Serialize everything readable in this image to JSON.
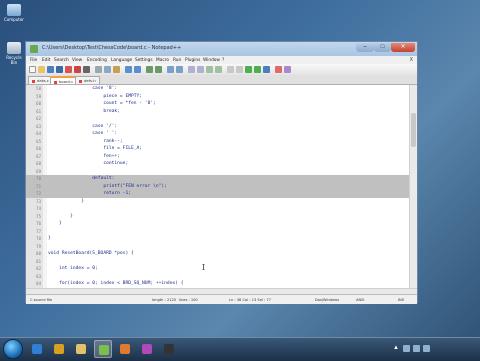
{
  "window": {
    "title": "C:\\Users\\Desktop\\Test\\ChessCode\\board.c - Notepad++",
    "min_glyph": "–",
    "max_glyph": "□",
    "close_glyph": "✕"
  },
  "desktop": {
    "icons": [
      {
        "label": "Computer",
        "icon": "computer-icon"
      },
      {
        "label": "Recycle Bin",
        "icon": "recycle-bin-icon"
      }
    ]
  },
  "menu": {
    "items": [
      "File",
      "Edit",
      "Search",
      "View",
      "Encoding",
      "Language",
      "Settings",
      "Macro",
      "Run",
      "Plugins",
      "Window",
      "?"
    ],
    "close_glyph": "X"
  },
  "tabs": [
    {
      "label": "data.c",
      "active": false
    },
    {
      "label": "board.c",
      "active": true
    },
    {
      "label": "defs.h",
      "active": false
    }
  ],
  "editor": {
    "selection_color": "#c0c0c0",
    "lines": [
      {
        "num": "58",
        "text": "                case '8':",
        "selected": false
      },
      {
        "num": "59",
        "text": "                    piece = EMPTY;",
        "selected": false
      },
      {
        "num": "60",
        "text": "                    count = *fen - '0';",
        "selected": false
      },
      {
        "num": "61",
        "text": "                    break;",
        "selected": false
      },
      {
        "num": "62",
        "text": "",
        "selected": false
      },
      {
        "num": "63",
        "text": "                case '/':",
        "selected": false
      },
      {
        "num": "64",
        "text": "                case ' ':",
        "selected": false
      },
      {
        "num": "65",
        "text": "                    rank--;",
        "selected": false
      },
      {
        "num": "66",
        "text": "                    file = FILE_A;",
        "selected": false
      },
      {
        "num": "67",
        "text": "                    fen++;",
        "selected": false
      },
      {
        "num": "68",
        "text": "                    continue;",
        "selected": false
      },
      {
        "num": "69",
        "text": "",
        "selected": false
      },
      {
        "num": "70",
        "text": "                default:",
        "selected": true
      },
      {
        "num": "71",
        "text": "                    printf(\"FEN error \\n\");",
        "selected": true
      },
      {
        "num": "72",
        "text": "                    return -1;",
        "selected": true
      },
      {
        "num": "73",
        "text": "            }",
        "selected": false
      },
      {
        "num": "74",
        "text": "",
        "selected": false
      },
      {
        "num": "75",
        "text": "        }",
        "selected": false
      },
      {
        "num": "76",
        "text": "    }",
        "selected": false
      },
      {
        "num": "77",
        "text": "",
        "selected": false
      },
      {
        "num": "78",
        "text": "}",
        "selected": false
      },
      {
        "num": "79",
        "text": "",
        "selected": false
      },
      {
        "num": "80",
        "text": "void ResetBoard(S_BOARD *pos) {",
        "selected": false
      },
      {
        "num": "81",
        "text": "",
        "selected": false
      },
      {
        "num": "82",
        "text": "    int index = 0;",
        "selected": false
      },
      {
        "num": "83",
        "text": "",
        "selected": false
      },
      {
        "num": "84",
        "text": "    for(index = 0; index < BRD_SQ_NUM; ++index) {",
        "selected": false
      },
      {
        "num": "85",
        "text": "        pos->pieces[index] = OFFBOARD;",
        "selected": false
      },
      {
        "num": "86",
        "text": "    }",
        "selected": false
      }
    ]
  },
  "status": {
    "file_type": "C source file",
    "length": "length : 2125",
    "lines": "lines : 100",
    "position": "Ln : 36    Col : 13    Sel : 77",
    "eol": "Dos\\Windows",
    "encoding": "ANSI",
    "mode": "INS"
  },
  "taskbar": {
    "apps": [
      {
        "icon": "internet-explorer-icon",
        "active": false,
        "color": "#2f7fd4"
      },
      {
        "icon": "chrome-icon",
        "active": false,
        "color": "#d8a020"
      },
      {
        "icon": "folder-icon",
        "active": false,
        "color": "#e3c06a"
      },
      {
        "icon": "notepad-plus-plus-icon",
        "active": true,
        "color": "#7cc04b"
      },
      {
        "icon": "media-player-icon",
        "active": false,
        "color": "#e07a30"
      },
      {
        "icon": "paint-icon",
        "active": false,
        "color": "#b04ab8"
      },
      {
        "icon": "terminal-icon",
        "active": false,
        "color": "#333333"
      }
    ],
    "tray_arrow": "▲"
  }
}
